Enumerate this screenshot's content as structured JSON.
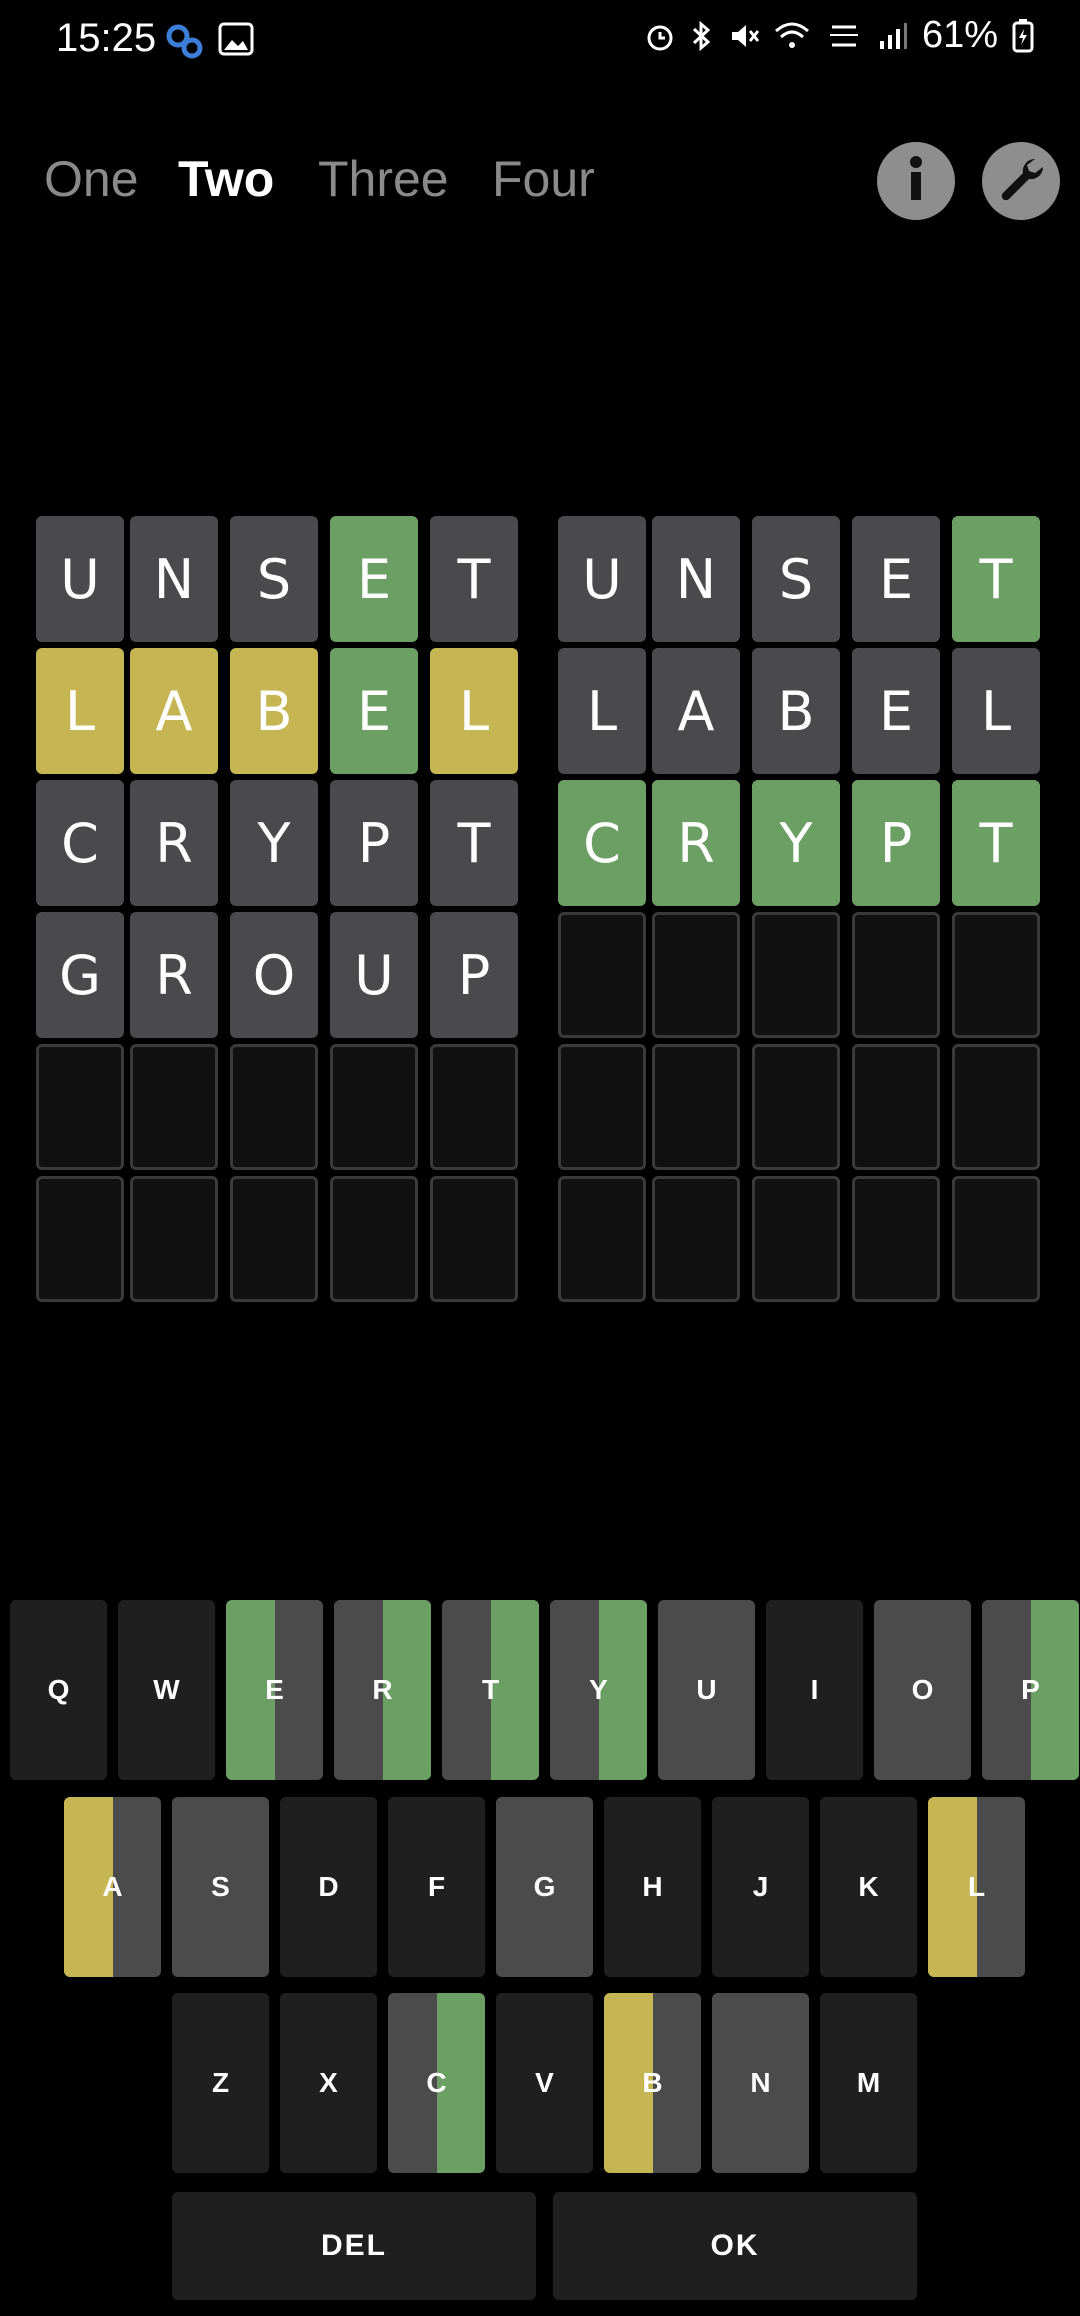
{
  "status": {
    "time": "15:25",
    "battery": "61%"
  },
  "tabs": [
    {
      "label": "One"
    },
    {
      "label": "Two"
    },
    {
      "label": "Three"
    },
    {
      "label": "Four"
    }
  ],
  "colors": {
    "green": "#6b9f64",
    "yellow": "#c6b553",
    "absent": "#4a4a4c",
    "key_dark": "#1f1f1f",
    "key_gray": "#4b4b4b"
  },
  "boards": [
    {
      "rows": [
        {
          "letters": [
            "U",
            "N",
            "S",
            "E",
            "T"
          ],
          "states": [
            "absent",
            "absent",
            "absent",
            "green",
            "absent"
          ]
        },
        {
          "letters": [
            "L",
            "A",
            "B",
            "E",
            "L"
          ],
          "states": [
            "yellow",
            "yellow",
            "yellow",
            "green",
            "yellow"
          ]
        },
        {
          "letters": [
            "C",
            "R",
            "Y",
            "P",
            "T"
          ],
          "states": [
            "absent",
            "absent",
            "absent",
            "absent",
            "absent"
          ]
        },
        {
          "letters": [
            "G",
            "R",
            "O",
            "U",
            "P"
          ],
          "states": [
            "absent",
            "absent",
            "absent",
            "absent",
            "absent"
          ]
        },
        {
          "letters": [
            "",
            "",
            "",
            "",
            ""
          ],
          "states": [
            "empty",
            "empty",
            "empty",
            "empty",
            "empty"
          ]
        },
        {
          "letters": [
            "",
            "",
            "",
            "",
            ""
          ],
          "states": [
            "empty",
            "empty",
            "empty",
            "empty",
            "empty"
          ]
        }
      ]
    },
    {
      "rows": [
        {
          "letters": [
            "U",
            "N",
            "S",
            "E",
            "T"
          ],
          "states": [
            "absent",
            "absent",
            "absent",
            "absent",
            "green"
          ]
        },
        {
          "letters": [
            "L",
            "A",
            "B",
            "E",
            "L"
          ],
          "states": [
            "absent",
            "absent",
            "absent",
            "absent",
            "absent"
          ]
        },
        {
          "letters": [
            "C",
            "R",
            "Y",
            "P",
            "T"
          ],
          "states": [
            "green",
            "green",
            "green",
            "green",
            "green"
          ]
        },
        {
          "letters": [
            "",
            "",
            "",
            "",
            ""
          ],
          "states": [
            "empty",
            "empty",
            "empty",
            "empty",
            "empty"
          ]
        },
        {
          "letters": [
            "",
            "",
            "",
            "",
            ""
          ],
          "states": [
            "empty",
            "empty",
            "empty",
            "empty",
            "empty"
          ]
        },
        {
          "letters": [
            "",
            "",
            "",
            "",
            ""
          ],
          "states": [
            "empty",
            "empty",
            "empty",
            "empty",
            "empty"
          ]
        }
      ]
    }
  ],
  "keyboard": {
    "rows": [
      [
        {
          "key": "Q",
          "left": "dark",
          "right": "dark"
        },
        {
          "key": "W",
          "left": "dark",
          "right": "dark"
        },
        {
          "key": "E",
          "left": "green",
          "right": "gray"
        },
        {
          "key": "R",
          "left": "gray",
          "right": "green"
        },
        {
          "key": "T",
          "left": "gray",
          "right": "green"
        },
        {
          "key": "Y",
          "left": "gray",
          "right": "green"
        },
        {
          "key": "U",
          "left": "gray",
          "right": "gray"
        },
        {
          "key": "I",
          "left": "dark",
          "right": "dark"
        },
        {
          "key": "O",
          "left": "gray",
          "right": "gray"
        },
        {
          "key": "P",
          "left": "gray",
          "right": "green"
        }
      ],
      [
        {
          "key": "A",
          "left": "yellow",
          "right": "gray"
        },
        {
          "key": "S",
          "left": "gray",
          "right": "gray"
        },
        {
          "key": "D",
          "left": "dark",
          "right": "dark"
        },
        {
          "key": "F",
          "left": "dark",
          "right": "dark"
        },
        {
          "key": "G",
          "left": "gray",
          "right": "gray"
        },
        {
          "key": "H",
          "left": "dark",
          "right": "dark"
        },
        {
          "key": "J",
          "left": "dark",
          "right": "dark"
        },
        {
          "key": "K",
          "left": "dark",
          "right": "dark"
        },
        {
          "key": "L",
          "left": "yellow",
          "right": "gray"
        }
      ],
      [
        {
          "key": "Z",
          "left": "dark",
          "right": "dark"
        },
        {
          "key": "X",
          "left": "dark",
          "right": "dark"
        },
        {
          "key": "C",
          "left": "gray",
          "right": "green"
        },
        {
          "key": "V",
          "left": "dark",
          "right": "dark"
        },
        {
          "key": "B",
          "left": "yellow",
          "right": "gray"
        },
        {
          "key": "N",
          "left": "gray",
          "right": "gray"
        },
        {
          "key": "M",
          "left": "dark",
          "right": "dark"
        }
      ]
    ],
    "del_label": "DEL",
    "ok_label": "OK"
  }
}
